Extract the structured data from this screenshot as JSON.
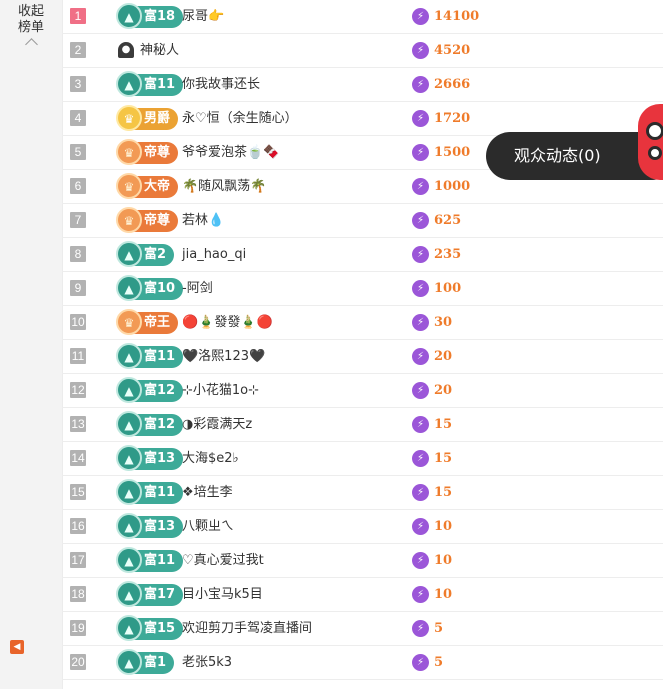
{
  "sidebar": {
    "collapse_label": "收起榜单",
    "badge_icon": "speaker-icon"
  },
  "audience_button": {
    "label": "观众动态(0)"
  },
  "colors": {
    "accent_orange": "#ef7b2a",
    "wealth_badge": "#3daa98",
    "noble_badge": "#ea7a3a",
    "noble_gold_badge": "#eba233",
    "first_rank": "#f06f86",
    "gift_icon": "#9b56d8"
  },
  "rows": [
    {
      "rank": "1",
      "badge": "富18",
      "badge_type": "wealth",
      "name": "尿哥👉",
      "amount": "14100"
    },
    {
      "rank": "2",
      "badge": "",
      "badge_type": "mystery",
      "name": "神秘人",
      "amount": "4520"
    },
    {
      "rank": "3",
      "badge": "富11",
      "badge_type": "wealth",
      "name": "你我故事还长",
      "amount": "2666"
    },
    {
      "rank": "4",
      "badge": "男爵",
      "badge_type": "noble-gold",
      "name": "永♡恒（余生随心）",
      "amount": "1720"
    },
    {
      "rank": "5",
      "badge": "帝尊",
      "badge_type": "noble-red",
      "name": "爷爷爱泡茶🍵🍫",
      "amount": "1500"
    },
    {
      "rank": "6",
      "badge": "大帝",
      "badge_type": "noble-red",
      "name": "🌴随风飘荡🌴",
      "amount": "1000"
    },
    {
      "rank": "7",
      "badge": "帝尊",
      "badge_type": "noble-red",
      "name": "若林💧",
      "amount": "625"
    },
    {
      "rank": "8",
      "badge": "富2",
      "badge_type": "wealth",
      "name": "jia_hao_qi",
      "amount": "235"
    },
    {
      "rank": "9",
      "badge": "富10",
      "badge_type": "wealth",
      "name": "-阿剑",
      "amount": "100"
    },
    {
      "rank": "10",
      "badge": "帝王",
      "badge_type": "noble-red",
      "name": "🔴🎍發發🎍🔴",
      "amount": "30"
    },
    {
      "rank": "11",
      "badge": "富11",
      "badge_type": "wealth",
      "name": "🖤洛熙123🖤",
      "amount": "20"
    },
    {
      "rank": "12",
      "badge": "富12",
      "badge_type": "wealth",
      "name": "⊹小花猫1o⊹",
      "amount": "20"
    },
    {
      "rank": "13",
      "badge": "富12",
      "badge_type": "wealth",
      "name": "◑彩霞满天z",
      "amount": "15"
    },
    {
      "rank": "14",
      "badge": "富13",
      "badge_type": "wealth",
      "name": "大海$e2♭",
      "amount": "15"
    },
    {
      "rank": "15",
      "badge": "富11",
      "badge_type": "wealth",
      "name": "❖培生李",
      "amount": "15"
    },
    {
      "rank": "16",
      "badge": "富13",
      "badge_type": "wealth",
      "name": "八颗ㄓㄟ",
      "amount": "10"
    },
    {
      "rank": "17",
      "badge": "富11",
      "badge_type": "wealth",
      "name": "♡真心爱过我t",
      "amount": "10"
    },
    {
      "rank": "18",
      "badge": "富17",
      "badge_type": "wealth",
      "name": "目小宝马k5目",
      "amount": "10"
    },
    {
      "rank": "19",
      "badge": "富15",
      "badge_type": "wealth",
      "name": "欢迎剪刀手驾凌直播间",
      "amount": "5"
    },
    {
      "rank": "20",
      "badge": "富1",
      "badge_type": "wealth",
      "name": "老张5k3",
      "amount": "5"
    }
  ]
}
